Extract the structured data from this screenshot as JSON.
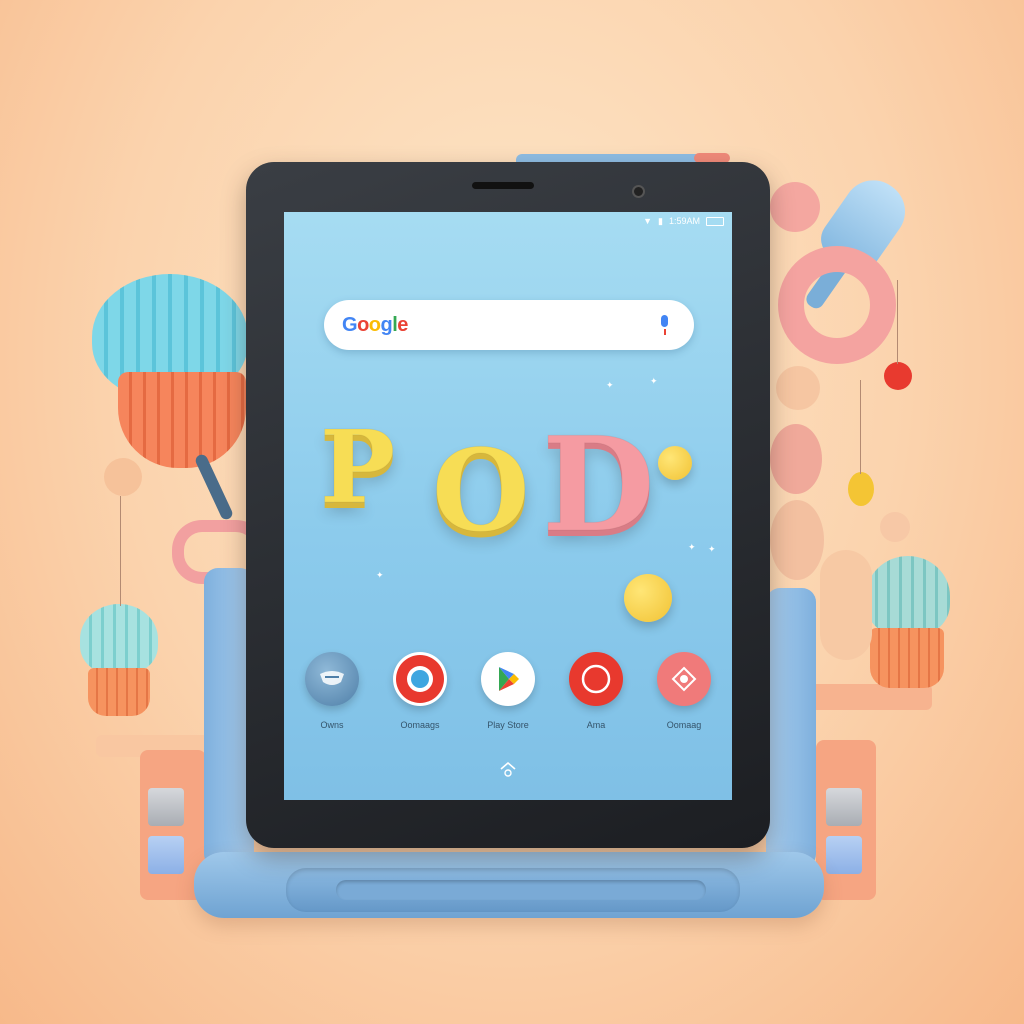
{
  "status_bar": {
    "time": "1:59AM"
  },
  "search": {
    "logo": "Google",
    "placeholder": ""
  },
  "wallpaper": {
    "letters": [
      "P",
      "O",
      "D"
    ]
  },
  "apps": [
    {
      "label": "Owns",
      "icon": "face-icon"
    },
    {
      "label": "Oomaags",
      "icon": "record-icon"
    },
    {
      "label": "Play Store",
      "icon": "play-store-icon"
    },
    {
      "label": "Ama",
      "icon": "circle-icon"
    },
    {
      "label": "Oomaag",
      "icon": "gallery-icon"
    }
  ],
  "colors": {
    "accent_yellow": "#f7dd55",
    "accent_pink": "#f59ba2",
    "screen_blue": "#8ccbec"
  }
}
